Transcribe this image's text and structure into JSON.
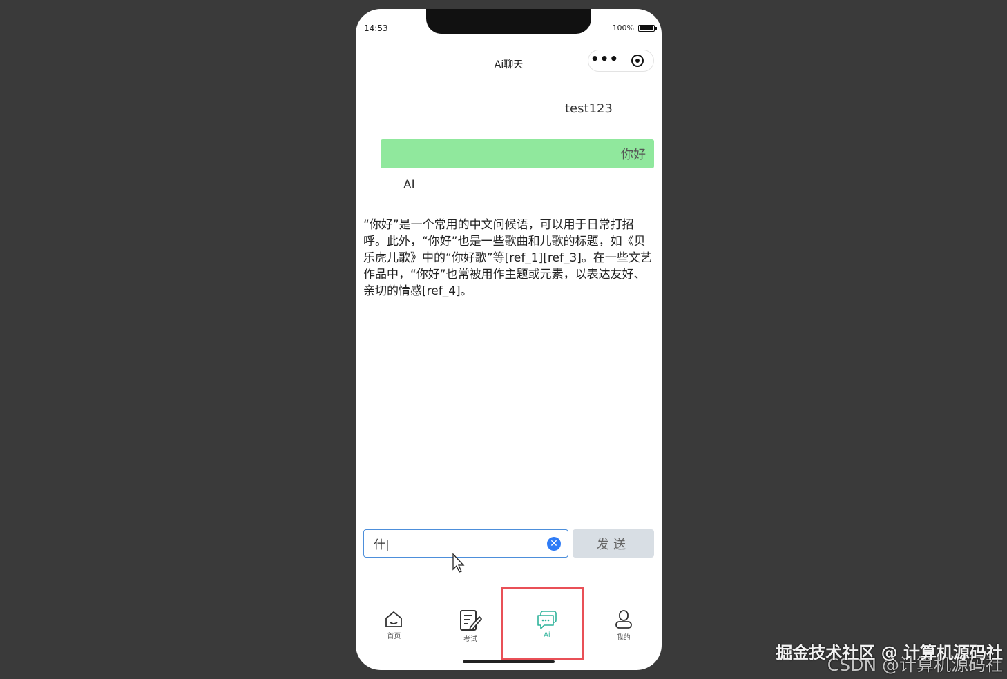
{
  "status_bar": {
    "time": "14:53",
    "battery_text": "100%"
  },
  "nav": {
    "title": "Ai聊天",
    "more_glyph": "•••"
  },
  "chat": {
    "user_name": "test123",
    "user_message": "你好",
    "ai_name": "AI",
    "ai_reply": "“你好”是一个常用的中文问候语，可以用于日常打招呼。此外，“你好”也是一些歌曲和儿歌的标题，如《贝乐虎儿歌》中的“你好歌”等[ref_1][ref_3]。在一些文艺作品中，“你好”也常被用作主题或元素，以表达友好、亲切的情感[ref_4]。",
    "user_bubble_color": "#90e89d"
  },
  "composer": {
    "input_value": "什|",
    "clear_glyph": "✕",
    "send_label": "发送"
  },
  "tabbar": {
    "active_color": "#2fb39b",
    "items": [
      {
        "label": "首页",
        "icon": "home-icon"
      },
      {
        "label": "考试",
        "icon": "exam-icon"
      },
      {
        "label": "Ai",
        "icon": "chat-icon"
      },
      {
        "label": "我的",
        "icon": "profile-icon"
      }
    ]
  },
  "highlight_color": "#e95057",
  "watermark": {
    "line1": "掘金技术社区 @ 计算机源码社",
    "line2": "CSDN @计算机源码社"
  }
}
